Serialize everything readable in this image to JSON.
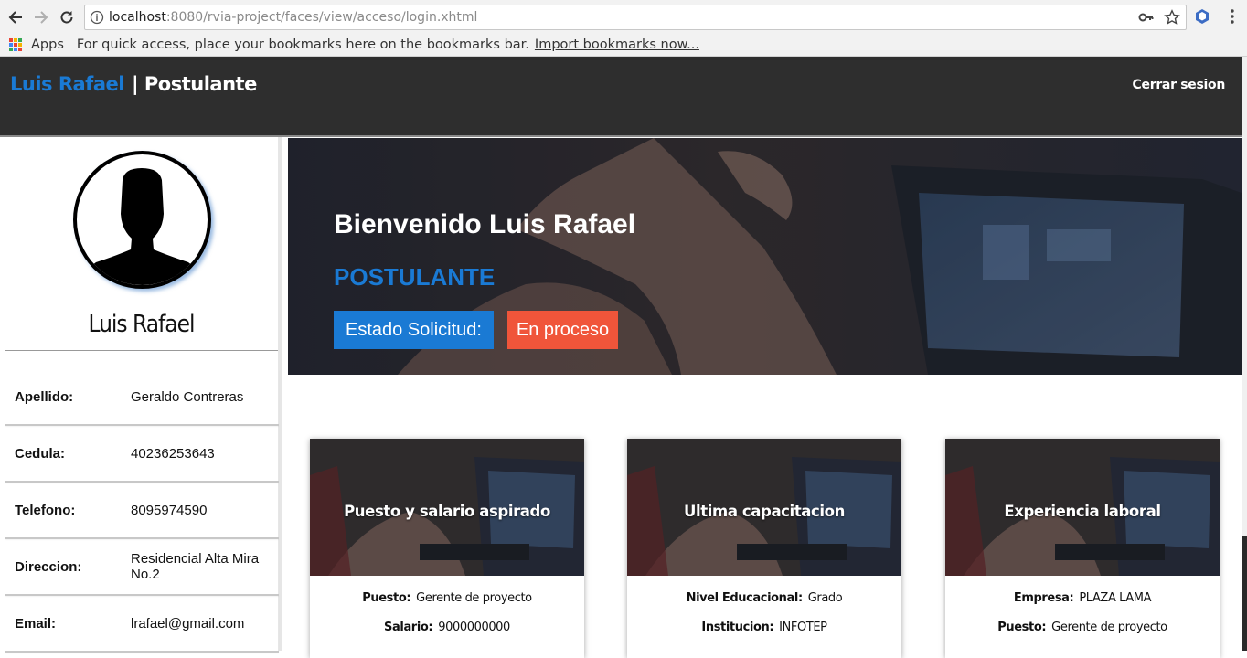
{
  "browser": {
    "url_host": "localhost",
    "url_path": ":8080/rvia-project/faces/view/acceso/login.xhtml",
    "bookmarks": {
      "apps_label": "Apps",
      "message": "For quick access, place your bookmarks here on the bookmarks bar.",
      "import_link": "Import bookmarks now..."
    }
  },
  "header": {
    "user_name": "Luis Rafael",
    "role_suffix": "| Postulante",
    "logout": "Cerrar sesion"
  },
  "profile": {
    "name": "Luis Rafael",
    "fields": [
      {
        "label": "Apellido:",
        "value": "Geraldo Contreras"
      },
      {
        "label": "Cedula:",
        "value": "40236253643"
      },
      {
        "label": "Telefono:",
        "value": "8095974590"
      },
      {
        "label": "Direccion:",
        "value": "Residencial Alta Mira No.2"
      },
      {
        "label": "Email:",
        "value": "lrafael@gmail.com"
      }
    ]
  },
  "hero": {
    "welcome": "Bienvenido Luis Rafael",
    "role": "POSTULANTE",
    "status_label": "Estado Solicitud:",
    "status_value": "En proceso",
    "colors": {
      "role": "#1a7ad4",
      "status_label_bg": "#1a7ad4",
      "status_value_bg": "#f0553a"
    }
  },
  "cards": [
    {
      "title": "Puesto y salario aspirado",
      "lines": [
        {
          "label": "Puesto:",
          "value": "Gerente de proyecto"
        },
        {
          "label": "Salario:",
          "value": "9000000000"
        }
      ]
    },
    {
      "title": "Ultima capacitacion",
      "lines": [
        {
          "label": "Nivel Educacional:",
          "value": "Grado"
        },
        {
          "label": "Institucion:",
          "value": "INFOTEP"
        }
      ]
    },
    {
      "title": "Experiencia laboral",
      "lines": [
        {
          "label": "Empresa:",
          "value": "PLAZA LAMA"
        },
        {
          "label": "Puesto:",
          "value": "Gerente de proyecto"
        }
      ]
    }
  ],
  "icons": {
    "back": "arrow-left-icon",
    "forward": "arrow-right-icon",
    "reload": "reload-icon",
    "info": "info-icon",
    "key": "key-icon",
    "star": "star-icon",
    "extension": "extension-icon",
    "menu": "kebab-menu-icon",
    "avatar": "user-silhouette-icon"
  }
}
